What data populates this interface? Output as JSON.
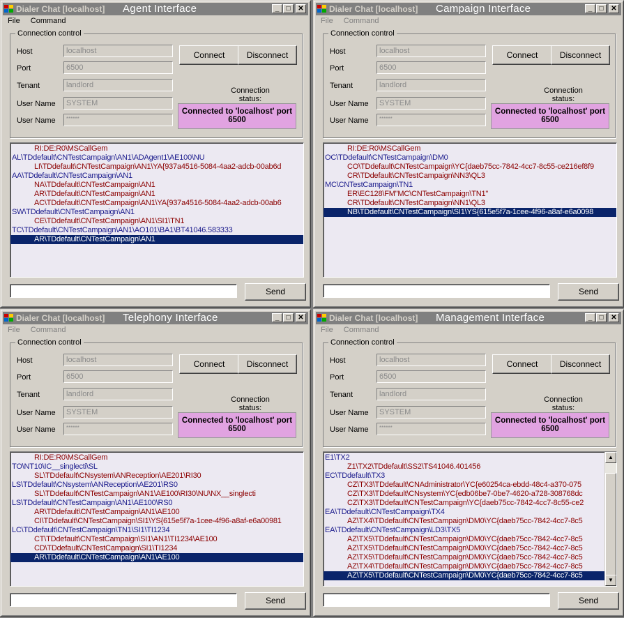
{
  "windows": [
    {
      "app_name": "Dialer Chat [localhost]",
      "title": "Agent Interface",
      "menu": [
        "File",
        "Command"
      ],
      "menu_disabled": false,
      "connection": {
        "group_label": "Connection control",
        "host_label": "Host",
        "host": "localhost",
        "port_label": "Port",
        "port": "6500",
        "tenant_label": "Tenant",
        "tenant": "landlord",
        "username_label": "User Name",
        "username": "SYSTEM",
        "password_label": "User Name",
        "password": "******",
        "connect": "Connect",
        "disconnect": "Disconnect",
        "status_label": "Connection status:",
        "status": "Connected to 'localhost' port 6500"
      },
      "log": [
        {
          "style": "red",
          "text": "RI:DE:R0\\MSCallGem"
        },
        {
          "style": "blue",
          "text": "AL\\TDdefault\\CNTestCampaign\\AN1\\ADAgent1\\AE100\\NU"
        },
        {
          "style": "red",
          "text": "LI\\TDdefault\\CNTestCampaign\\AN1\\YA{937a4516-5084-4aa2-adcb-00ab6d"
        },
        {
          "style": "blue",
          "text": "AA\\TDdefault\\CNTestCampaign\\AN1"
        },
        {
          "style": "red",
          "text": "NA\\TDdefault\\CNTestCampaign\\AN1"
        },
        {
          "style": "red",
          "text": "AR\\TDdefault\\CNTestCampaign\\AN1"
        },
        {
          "style": "red",
          "text": "AC\\TDdefault\\CNTestCampaign\\AN1\\YA{937a4516-5084-4aa2-adcb-00ab6"
        },
        {
          "style": "blue",
          "text": "SW\\TDdefault\\CNTestCampaign\\AN1"
        },
        {
          "style": "red",
          "text": "CE\\TDdefault\\CNTestCampaign\\AN1\\SI1\\TN1"
        },
        {
          "style": "blue",
          "text": "TC\\TDdefault\\CNTestCampaign\\AN1\\AO101\\BA1\\BT41046.583333"
        },
        {
          "style": "sel",
          "text": "AR\\TDdefault\\CNTestCampaign\\AN1"
        }
      ],
      "scrollbar": false,
      "send_value": "",
      "send_label": "Send"
    },
    {
      "app_name": "Dialer Chat [localhost]",
      "title": "Campaign Interface",
      "menu": [
        "File",
        "Command"
      ],
      "menu_disabled": true,
      "connection": {
        "group_label": "Connection control",
        "host_label": "Host",
        "host": "localhost",
        "port_label": "Port",
        "port": "6500",
        "tenant_label": "Tenant",
        "tenant": "landlord",
        "username_label": "User Name",
        "username": "SYSTEM",
        "password_label": "User Name",
        "password": "******",
        "connect": "Connect",
        "disconnect": "Disconnect",
        "status_label": "Connection status:",
        "status": "Connected to 'localhost' port 6500"
      },
      "log": [
        {
          "style": "red",
          "text": "RI:DE:R0\\MSCallGem"
        },
        {
          "style": "blue",
          "text": "OC\\TDdefault\\CNTestCampaign\\DM0"
        },
        {
          "style": "red",
          "text": "CO\\TDdefault\\CNTestCampaign\\YC{daeb75cc-7842-4cc7-8c55-ce216ef8f9"
        },
        {
          "style": "red",
          "text": "CR\\TDdefault\\CNTestCampaign\\NN3\\QL3"
        },
        {
          "style": "blue",
          "text": "MC\\CNTestCampaign\\TN1"
        },
        {
          "style": "red",
          "text": "ER\\EC128\\FM\"MC\\CNTestCampaign\\TN1\""
        },
        {
          "style": "red",
          "text": "CR\\TDdefault\\CNTestCampaign\\NN1\\QL3"
        },
        {
          "style": "sel",
          "text": "NB\\TDdefault\\CNTestCampaign\\SI1\\YS{615e5f7a-1cee-4f96-a8af-e6a0098"
        }
      ],
      "scrollbar": false,
      "send_value": "",
      "send_label": "Send"
    },
    {
      "app_name": "Dialer Chat [localhost]",
      "title": "Telephony Interface",
      "menu": [
        "File",
        "Command"
      ],
      "menu_disabled": true,
      "connection": {
        "group_label": "Connection control",
        "host_label": "Host",
        "host": "localhost",
        "port_label": "Port",
        "port": "6500",
        "tenant_label": "Tenant",
        "tenant": "landlord",
        "username_label": "User Name",
        "username": "SYSTEM",
        "password_label": "User Name",
        "password": "******",
        "connect": "Connect",
        "disconnect": "Disconnect",
        "status_label": "Connection status:",
        "status": "Connected to 'localhost' port 6500"
      },
      "log": [
        {
          "style": "red",
          "text": "RI:DE:R0\\MSCallGem"
        },
        {
          "style": "blue",
          "text": "TO\\NT10\\IC__singlecti\\SL"
        },
        {
          "style": "red",
          "text": "SL\\TDdefault\\CNsystem\\ANReception\\AE201\\RI30"
        },
        {
          "style": "blue",
          "text": "LS\\TDdefault\\CNsystem\\ANReception\\AE201\\RS0"
        },
        {
          "style": "red",
          "text": "SL\\TDdefault\\CNTestCampaign\\AN1\\AE100\\RI30\\NU\\NX__singlecti"
        },
        {
          "style": "blue",
          "text": "LS\\TDdefault\\CNTestCampaign\\AN1\\AE100\\RS0"
        },
        {
          "style": "red",
          "text": "AR\\TDdefault\\CNTestCampaign\\AN1\\AE100"
        },
        {
          "style": "red",
          "text": "CI\\TDdefault\\CNTestCampaign\\SI1\\YS{615e5f7a-1cee-4f96-a8af-e6a00981"
        },
        {
          "style": "blue",
          "text": "LC\\TDdefault\\CNTestCampaign\\TN1\\SI1\\TI1234"
        },
        {
          "style": "red",
          "text": "CT\\TDdefault\\CNTestCampaign\\SI1\\AN1\\TI1234\\AE100"
        },
        {
          "style": "red",
          "text": "CD\\TDdefault\\CNTestCampaign\\SI1\\TI1234"
        },
        {
          "style": "sel",
          "text": "AR\\TDdefault\\CNTestCampaign\\AN1\\AE100"
        }
      ],
      "scrollbar": false,
      "send_value": "",
      "send_label": "Send"
    },
    {
      "app_name": "Dialer Chat [localhost]",
      "title": "Management Interface",
      "menu": [
        "File",
        "Command"
      ],
      "menu_disabled": true,
      "connection": {
        "group_label": "Connection control",
        "host_label": "Host",
        "host": "localhost",
        "port_label": "Port",
        "port": "6500",
        "tenant_label": "Tenant",
        "tenant": "landlord",
        "username_label": "User Name",
        "username": "SYSTEM",
        "password_label": "User Name",
        "password": "******",
        "connect": "Connect",
        "disconnect": "Disconnect",
        "status_label": "Connection status:",
        "status": "Connected to 'localhost' port 6500"
      },
      "log": [
        {
          "style": "blue",
          "text": "E1\\TX2"
        },
        {
          "style": "red",
          "text": "Z1\\TX2\\TDdefault\\SS2\\TS41046.401456"
        },
        {
          "style": "blue",
          "text": "EC\\TDdefault\\TX3"
        },
        {
          "style": "red",
          "text": "CZ\\TX3\\TDdefault\\CNAdministrator\\YC{e60254ca-ebdd-48c4-a370-075"
        },
        {
          "style": "red",
          "text": "CZ\\TX3\\TDdefault\\CNsystem\\YC{edb06be7-0be7-4620-a728-308768dc"
        },
        {
          "style": "red",
          "text": "CZ\\TX3\\TDdefault\\CNTestCampaign\\YC{daeb75cc-7842-4cc7-8c55-ce2"
        },
        {
          "style": "blue",
          "text": "EA\\TDdefault\\CNTestCampaign\\TX4"
        },
        {
          "style": "red",
          "text": "AZ\\TX4\\TDdefault\\CNTestCampaign\\DM0\\YC{daeb75cc-7842-4cc7-8c5"
        },
        {
          "style": "blue",
          "text": "EA\\TDdefault\\CNTestCampaign\\LD3\\TX5"
        },
        {
          "style": "red",
          "text": "AZ\\TX5\\TDdefault\\CNTestCampaign\\DM0\\YC{daeb75cc-7842-4cc7-8c5"
        },
        {
          "style": "red",
          "text": "AZ\\TX5\\TDdefault\\CNTestCampaign\\DM0\\YC{daeb75cc-7842-4cc7-8c5"
        },
        {
          "style": "red",
          "text": "AZ\\TX5\\TDdefault\\CNTestCampaign\\DM0\\YC{daeb75cc-7842-4cc7-8c5"
        },
        {
          "style": "red",
          "text": "AZ\\TX4\\TDdefault\\CNTestCampaign\\DM0\\YC{daeb75cc-7842-4cc7-8c5"
        },
        {
          "style": "sel",
          "text": "AZ\\TX5\\TDdefault\\CNTestCampaign\\DM0\\YC{daeb75cc-7842-4cc7-8c5"
        }
      ],
      "scrollbar": true,
      "send_value": "",
      "send_label": "Send"
    }
  ]
}
